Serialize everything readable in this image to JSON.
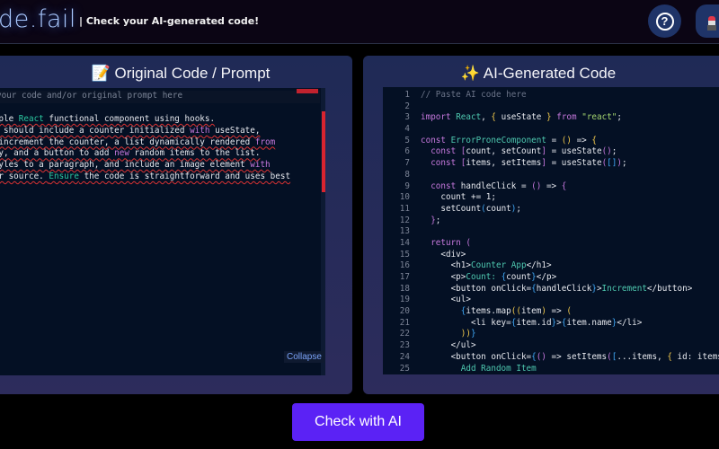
{
  "header": {
    "logo": "de.fail",
    "tagline": "| Check your AI-generated code!",
    "help_label": "?"
  },
  "left": {
    "title": "📝 Original Code / Prompt",
    "placeholder": "your code and/or original prompt here",
    "collapse": "Collapse",
    "lines": [
      [
        [
          "n",
          " simple "
        ],
        [
          "g",
          "React"
        ],
        [
          "n",
          " functional component using hooks."
        ]
      ],
      [
        [
          "n",
          "nent should include a counter initialized "
        ],
        [
          "p",
          "with"
        ],
        [
          "n",
          " useState,"
        ]
      ],
      [
        [
          "n",
          " to increment the counter, a list dynamically rendered "
        ],
        [
          "p",
          "from"
        ]
      ],
      [
        [
          "n",
          "array, and a button to add "
        ],
        [
          "p",
          "new"
        ],
        [
          "n",
          " random items to the list."
        ]
      ],
      [
        [
          "n",
          "e styles to a paragraph, and include an image element "
        ],
        [
          "p",
          "with"
        ]
      ],
      [
        [
          "n",
          "older source. "
        ],
        [
          "g",
          "Ensure"
        ],
        [
          "n",
          " the code is straightforward and uses best"
        ]
      ],
      [
        [
          "n",
          "."
        ]
      ]
    ]
  },
  "right": {
    "title": "✨ AI-Generated Code",
    "code": [
      [
        [
          "cm",
          "// Paste AI code here"
        ]
      ],
      [],
      [
        [
          "kw",
          "import"
        ],
        [
          "op",
          " "
        ],
        [
          "id",
          "React"
        ],
        [
          "op",
          ", "
        ],
        [
          "br",
          "{"
        ],
        [
          "op",
          " useState "
        ],
        [
          "br",
          "}"
        ],
        [
          "op",
          " "
        ],
        [
          "kw",
          "from"
        ],
        [
          "op",
          " "
        ],
        [
          "st",
          "\"react\""
        ],
        [
          "op",
          ";"
        ]
      ],
      [],
      [
        [
          "kw",
          "const"
        ],
        [
          "op",
          " "
        ],
        [
          "id",
          "ErrorProneComponent"
        ],
        [
          "op",
          " = "
        ],
        [
          "br",
          "()"
        ],
        [
          "op",
          " => "
        ],
        [
          "br",
          "{"
        ]
      ],
      [
        [
          "kw",
          "  const"
        ],
        [
          "op",
          " "
        ],
        [
          "kw",
          "["
        ],
        [
          "op",
          "count, setCount"
        ],
        [
          "kw",
          "]"
        ],
        [
          "op",
          " = useState"
        ],
        [
          "kw",
          "()"
        ],
        [
          "op",
          ";"
        ]
      ],
      [
        [
          "kw",
          "  const"
        ],
        [
          "op",
          " "
        ],
        [
          "kw",
          "["
        ],
        [
          "op",
          "items, setItems"
        ],
        [
          "kw",
          "]"
        ],
        [
          "op",
          " = useState"
        ],
        [
          "kw",
          "("
        ],
        [
          "bl",
          "[]"
        ],
        [
          "kw",
          ")"
        ],
        [
          "op",
          ";"
        ]
      ],
      [],
      [
        [
          "kw",
          "  const"
        ],
        [
          "op",
          " handleClick = "
        ],
        [
          "kw",
          "()"
        ],
        [
          "op",
          " => "
        ],
        [
          "kw",
          "{"
        ]
      ],
      [
        [
          "op",
          "    count += 1;"
        ]
      ],
      [
        [
          "op",
          "    setCount"
        ],
        [
          "bl",
          "("
        ],
        [
          "op",
          "count"
        ],
        [
          "bl",
          ")"
        ],
        [
          "op",
          ";"
        ]
      ],
      [
        [
          "kw",
          "  }"
        ],
        [
          "op",
          ";"
        ]
      ],
      [],
      [
        [
          "kw",
          "  return"
        ],
        [
          "op",
          " "
        ],
        [
          "kw",
          "("
        ]
      ],
      [
        [
          "op",
          "    <div>"
        ]
      ],
      [
        [
          "op",
          "      <h1>"
        ],
        [
          "tx",
          "Counter App"
        ],
        [
          "op",
          "</h1>"
        ]
      ],
      [
        [
          "op",
          "      <p>"
        ],
        [
          "tx",
          "Count: "
        ],
        [
          "bl",
          "{"
        ],
        [
          "op",
          "count"
        ],
        [
          "bl",
          "}"
        ],
        [
          "op",
          "</p>"
        ]
      ],
      [
        [
          "op",
          "      <button onClick="
        ],
        [
          "bl",
          "{"
        ],
        [
          "op",
          "handleClick"
        ],
        [
          "bl",
          "}"
        ],
        [
          "op",
          ">"
        ],
        [
          "tx",
          "Increment"
        ],
        [
          "op",
          "</button>"
        ]
      ],
      [
        [
          "op",
          "      <ul>"
        ]
      ],
      [
        [
          "bl",
          "        {"
        ],
        [
          "op",
          "items.map"
        ],
        [
          "br",
          "(("
        ],
        [
          "op",
          "item"
        ],
        [
          "br",
          ")"
        ],
        [
          "op",
          " => "
        ],
        [
          "br",
          "("
        ]
      ],
      [
        [
          "op",
          "          <li key="
        ],
        [
          "bl",
          "{"
        ],
        [
          "op",
          "item.id"
        ],
        [
          "bl",
          "}"
        ],
        [
          "op",
          ">"
        ],
        [
          "bl",
          "{"
        ],
        [
          "op",
          "item.name"
        ],
        [
          "bl",
          "}"
        ],
        [
          "op",
          "</li>"
        ]
      ],
      [
        [
          "br",
          "        ))"
        ],
        [
          "bl",
          "}"
        ]
      ],
      [
        [
          "op",
          "      </ul>"
        ]
      ],
      [
        [
          "op",
          "      <button onClick="
        ],
        [
          "bl",
          "{"
        ],
        [
          "kw",
          "()"
        ],
        [
          "op",
          " => setItems"
        ],
        [
          "kw",
          "("
        ],
        [
          "bl",
          "["
        ],
        [
          "op",
          "...items, "
        ],
        [
          "br",
          "{"
        ],
        [
          "op",
          " id: items.leng"
        ]
      ],
      [
        [
          "tx",
          "        Add Random Item"
        ]
      ]
    ]
  },
  "check_button": "Check with AI"
}
